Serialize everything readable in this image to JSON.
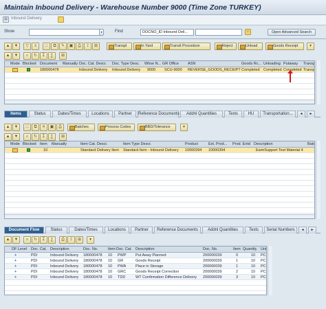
{
  "window": {
    "title": "Maintain Inbound Delivery - Warehouse Number 9000 (Time Zone TURKEY)",
    "subtoolbar_label": "Inbound Delivery"
  },
  "search": {
    "show_label": "Show",
    "show_value": "",
    "find_label": "Find",
    "find_field": "DOCNO_ID Inbound Deli...",
    "find_value": "",
    "advanced_button": "Open Advanced Search"
  },
  "header_toolbar": {
    "buttons": [
      "TranspI",
      "In Yard",
      "Transit Procedure",
      "Reject",
      "Unload",
      "Goods Receipt"
    ]
  },
  "header_grid": {
    "columns": [
      "Mode",
      "Blocked",
      "Document",
      "Manually",
      "Doc. Cat. Descr.",
      "Doc. Type Desc.",
      "Whse N...",
      "GR Office",
      "ASN",
      "Goods Rc...",
      "Unloading",
      "Putaway",
      "Transport"
    ],
    "row": {
      "document": "180000478",
      "doc_cat": "Inbound Delivery",
      "doc_type": "Inbound Delivery",
      "whse": "9000",
      "gr_office": "SCU-9000",
      "asn": "REVERSE_GOODS_RECEIPT",
      "goods_rc": "Completed",
      "unloading": "Completed",
      "putaway": "Completed",
      "transport": "Transport Regist"
    }
  },
  "item_tabs": [
    "Items",
    "Status",
    "Dates/Times",
    "Locations",
    "Partner",
    "Reference Documents",
    "Addnl Quantities",
    "Texts",
    "HU",
    "Transportation..."
  ],
  "item_toolbar": {
    "buttons": [
      "Batches",
      "Process Codes",
      "BBD/Tolerance"
    ]
  },
  "item_grid": {
    "columns": [
      "Mode",
      "Blocked",
      "Item",
      "Manually",
      "Item Cat. Descr.",
      "Item Type Descr.",
      "Product",
      "Ext. Prod...",
      "Prod. Entd",
      "Description",
      "Batch"
    ],
    "row": {
      "item": "10",
      "item_cat": "Standard Delivery Item",
      "item_type": "Standard Item - Inbound Delivery",
      "product": "10000394",
      "ext_prod": "10000394",
      "description": "EwmSupport Test Material 4"
    }
  },
  "flow_tabs": [
    "Document Flow",
    "Status",
    "Dates/Times",
    "Locations",
    "Partner",
    "Reference Documents",
    "Addnl Quantities",
    "Texts",
    "Serial Numbers"
  ],
  "flow_grid": {
    "columns": [
      "DF Level",
      "Doc. Cat.",
      "Description",
      "Doc. No.",
      "Item",
      "Doc. Cat.",
      "Description",
      "Doc. No.",
      "Item",
      "Quantity",
      "Unit"
    ],
    "rows": [
      {
        "lvl": "+",
        "cat": "PDI",
        "desc": "Inbound Delivery",
        "docno": "180000478",
        "item": "10",
        "cat2": "PWP",
        "desc2": "Put Away Planned",
        "docno2": "200000039",
        "item2": "0",
        "qty": "10",
        "unit": "PC"
      },
      {
        "lvl": "+",
        "cat": "PDI",
        "desc": "Inbound Delivery",
        "docno": "180000478",
        "item": "10",
        "cat2": "GR",
        "desc2": "Goods Receipt",
        "docno2": "200000039",
        "item2": "1",
        "qty": "10",
        "unit": "PC"
      },
      {
        "lvl": "+",
        "cat": "PDI",
        "desc": "Inbound Delivery",
        "docno": "180000478",
        "item": "10",
        "cat2": "PWA",
        "desc2": "Place in Storage",
        "docno2": "200000039",
        "item2": "1",
        "qty": "10",
        "unit": "PC"
      },
      {
        "lvl": "+",
        "cat": "PDI",
        "desc": "Inbound Delivery",
        "docno": "180000478",
        "item": "10",
        "cat2": "GRC",
        "desc2": "Goods Receipt Correction",
        "docno2": "200000039",
        "item2": "2",
        "qty": "10",
        "unit": "PC"
      },
      {
        "lvl": "+",
        "cat": "PDI",
        "desc": "Inbound Delivery",
        "docno": "180000478",
        "item": "10",
        "cat2": "TDD",
        "desc2": "WT Confirmation Difference Delivery",
        "docno2": "200000039",
        "item2": "3",
        "qty": "10",
        "unit": "PC"
      }
    ]
  }
}
